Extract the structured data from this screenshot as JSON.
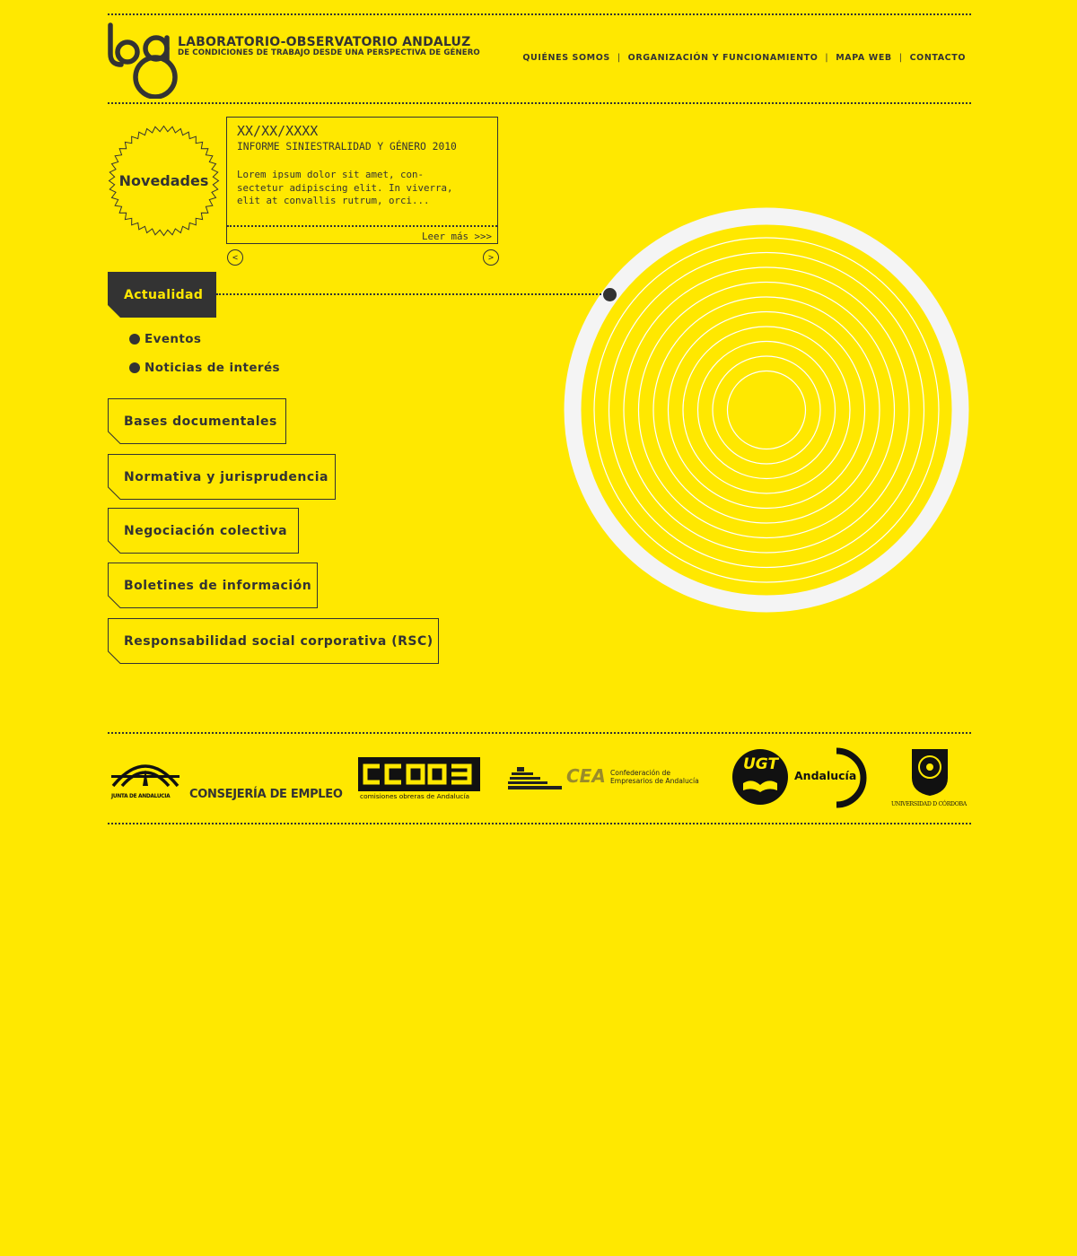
{
  "header": {
    "title": "LABORATORIO-OBSERVATORIO ANDALUZ",
    "subtitle": "DE CONDICIONES DE TRABAJO DESDE UNA PERSPECTIVA DE GÉNERO",
    "logo_icon": "log-logo-icon",
    "nav": [
      {
        "label": "QUIÉNES SOMOS"
      },
      {
        "label": "ORGANIZACIÓN Y FUNCIONAMIENTO"
      },
      {
        "label": "MAPA WEB"
      },
      {
        "label": "CONTACTO"
      }
    ],
    "nav_separator": "|"
  },
  "novedades": {
    "badge_label": "Novedades",
    "date": "XX/XX/XXXX",
    "headline": "INFORME SINIESTRALIDAD Y GÉNERO 2010",
    "excerpt": "Lorem ipsum dolor sit amet, con-\nsectetur adipiscing elit. In viverra,\nelit at convallis rutrum, orci...",
    "read_more": "Leer más >>>",
    "prev_label": "<",
    "next_label": ">"
  },
  "menu": {
    "active_tab": "Actualidad",
    "subitems": [
      {
        "label": "Eventos"
      },
      {
        "label": "Noticias de interés"
      }
    ],
    "sections": [
      {
        "label": "Bases documentales"
      },
      {
        "label": "Normativa y jurisprudencia"
      },
      {
        "label": "Negociación colectiva"
      },
      {
        "label": "Boletines de información"
      },
      {
        "label": "Responsabilidad social corporativa (RSC)"
      }
    ]
  },
  "partners": {
    "junta_label": "JUNTA DE ANDALUCIA",
    "consejeria_label": "CONSEJERÍA DE EMPLEO",
    "ccoo_label": "comisiones obreras de Andalucía",
    "cea_label": "CEA",
    "cea_caption": "Confederación de\nEmpresarios de Andalucía",
    "ugt_label": "UGT",
    "ugt_region": "Andalucía",
    "uco_label": "UNIVERSIDAD D CÓRDOBA"
  },
  "colors": {
    "background": "#FFE800",
    "ink": "#333333",
    "circle_ring": "#F4F4F4"
  }
}
